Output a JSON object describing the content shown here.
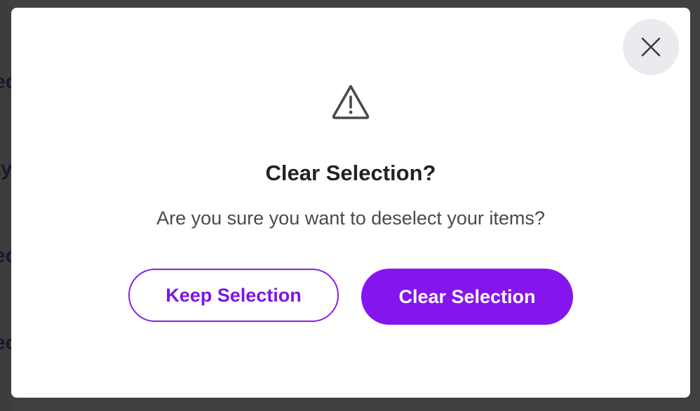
{
  "background": {
    "fragments": [
      "ec",
      "ty",
      "ec",
      "ec"
    ]
  },
  "dialog": {
    "title": "Clear Selection?",
    "message": "Are you sure you want to deselect your items?",
    "icon": "warning-triangle-icon",
    "close_icon": "close-icon",
    "keep_label": "Keep Selection",
    "clear_label": "Clear Selection"
  },
  "colors": {
    "accent": "#8415ec",
    "accent_text": "#7b17e0",
    "title_text": "#222222",
    "body_text": "#4a4a4a",
    "close_bg": "#ebebef",
    "backdrop": "#404040"
  }
}
